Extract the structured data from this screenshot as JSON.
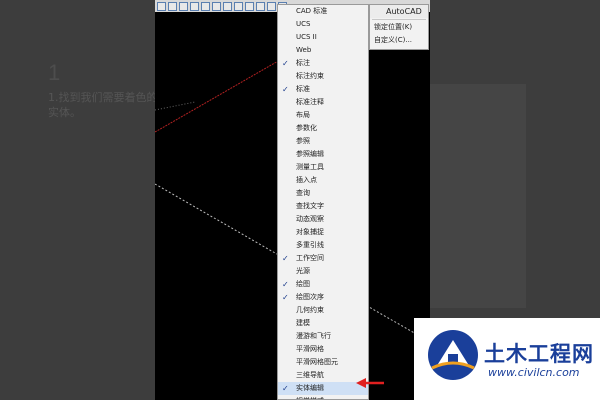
{
  "tutorial": {
    "step_number": "1",
    "step_text": "1.找到我们需要着色的实体。"
  },
  "menu": {
    "items": [
      {
        "label": "CAD 标准",
        "checked": false
      },
      {
        "label": "UCS",
        "checked": false
      },
      {
        "label": "UCS II",
        "checked": false
      },
      {
        "label": "Web",
        "checked": false
      },
      {
        "label": "标注",
        "checked": true
      },
      {
        "label": "标注约束",
        "checked": false
      },
      {
        "label": "标准",
        "checked": true
      },
      {
        "label": "标准注释",
        "checked": false
      },
      {
        "label": "布局",
        "checked": false
      },
      {
        "label": "参数化",
        "checked": false
      },
      {
        "label": "参照",
        "checked": false
      },
      {
        "label": "参照编辑",
        "checked": false
      },
      {
        "label": "测量工具",
        "checked": false
      },
      {
        "label": "插入点",
        "checked": false
      },
      {
        "label": "查询",
        "checked": false
      },
      {
        "label": "查找文字",
        "checked": false
      },
      {
        "label": "动态观察",
        "checked": false
      },
      {
        "label": "对象捕捉",
        "checked": false
      },
      {
        "label": "多重引线",
        "checked": false
      },
      {
        "label": "工作空间",
        "checked": true
      },
      {
        "label": "光源",
        "checked": false
      },
      {
        "label": "绘图",
        "checked": true
      },
      {
        "label": "绘图次序",
        "checked": true
      },
      {
        "label": "几何约束",
        "checked": false
      },
      {
        "label": "建模",
        "checked": false
      },
      {
        "label": "漫游和飞行",
        "checked": false
      },
      {
        "label": "平滑网格",
        "checked": false
      },
      {
        "label": "平滑网格图元",
        "checked": false
      },
      {
        "label": "三维导航",
        "checked": false
      },
      {
        "label": "实体编辑",
        "checked": true
      },
      {
        "label": "视觉样式",
        "checked": false
      }
    ],
    "check_glyph": "✓"
  },
  "submenu": {
    "header": "AutoCAD",
    "items": [
      "锁定位置(K)",
      "自定义(C)..."
    ]
  },
  "watermark": {
    "title": "土木工程网",
    "url": "www.civilcn.com",
    "color": "#1a3f9a"
  },
  "colors": {
    "canvas": "#000000",
    "menu_bg": "#f2f2f2",
    "selected": "#cfe0f5",
    "arrow": "#e02020"
  }
}
